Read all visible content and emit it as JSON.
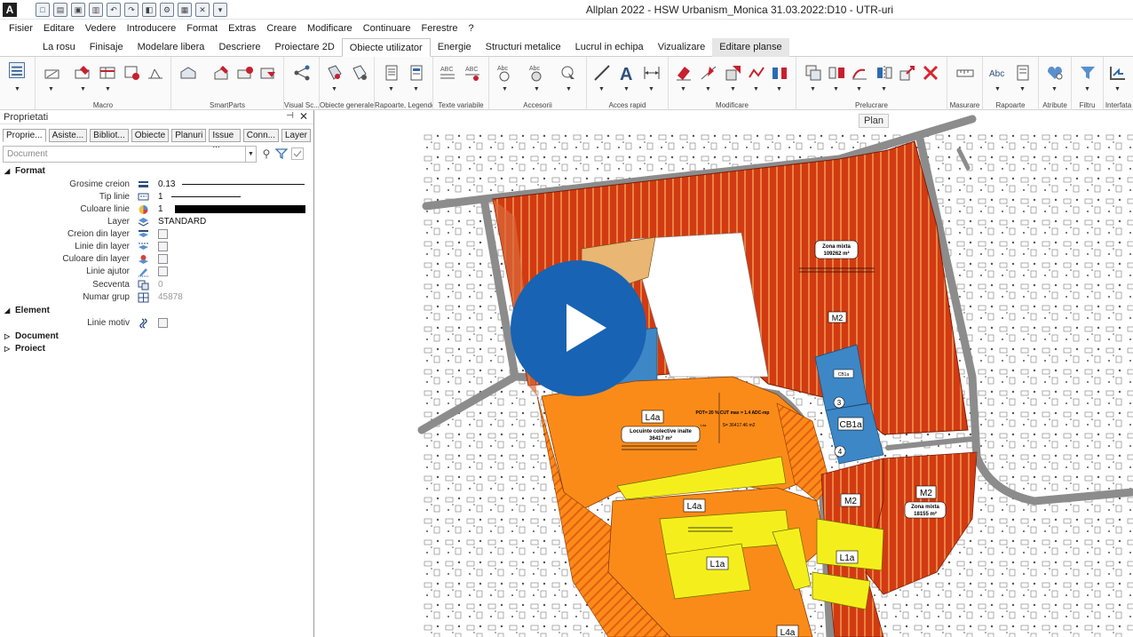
{
  "window": {
    "app_logo": "A",
    "title": "Allplan 2022 - HSW Urbanism_Monica 31.03.2022:D10 - UTR-uri"
  },
  "menu": [
    "Fisier",
    "Editare",
    "Vedere",
    "Introducere",
    "Format",
    "Extras",
    "Creare",
    "Modificare",
    "Continuare",
    "Ferestre",
    "?"
  ],
  "ribbon_tabs": [
    {
      "label": "La rosu"
    },
    {
      "label": "Finisaje"
    },
    {
      "label": "Modelare libera"
    },
    {
      "label": "Descriere"
    },
    {
      "label": "Proiectare 2D"
    },
    {
      "label": "Obiecte utilizator",
      "active": true
    },
    {
      "label": "Energie"
    },
    {
      "label": "Structuri metalice"
    },
    {
      "label": "Lucrul in echipa"
    },
    {
      "label": "Vizualizare"
    },
    {
      "label": "Editare planse",
      "special": true
    }
  ],
  "ribbon_groups": [
    "Macro",
    "SmartParts",
    "Visual Sc...",
    "Obiecte generale",
    "Rapoarte, Legende",
    "Texte variabile",
    "Accesorii",
    "Acces rapid",
    "Modificare",
    "Prelucrare",
    "Masurare",
    "Rapoarte",
    "Atribute",
    "Filtru",
    "Interfata"
  ],
  "ribbon_text": {
    "abc1": "ABC",
    "abc2": "ABC",
    "abc3": "Abc",
    "abc4": "Abc",
    "letter_a": "A"
  },
  "panel": {
    "title": "Proprietati",
    "pin": "⊣",
    "close": "✕",
    "tabs": [
      "Proprie...",
      "Asiste...",
      "Bibliot...",
      "Obiecte",
      "Planuri",
      "Issue ...",
      "Conn...",
      "Layer"
    ],
    "search_placeholder": "Document",
    "sections": {
      "format": "Format",
      "element": "Element",
      "document": "Document",
      "project": "Proiect"
    },
    "format_rows": {
      "pen": {
        "label": "Grosime creion",
        "value": "0.13"
      },
      "linetype": {
        "label": "Tip linie",
        "value": "1"
      },
      "linecolor": {
        "label": "Culoare linie",
        "value": "1"
      },
      "layer": {
        "label": "Layer",
        "value": "STANDARD"
      },
      "pen_from_layer": {
        "label": "Creion din layer"
      },
      "line_from_layer": {
        "label": "Linie din layer"
      },
      "color_from_layer": {
        "label": "Culoare din layer"
      },
      "helper_line": {
        "label": "Linie ajutor"
      },
      "sequence": {
        "label": "Secventa",
        "value": "0"
      },
      "group_number": {
        "label": "Numar grup",
        "value": "45878"
      }
    },
    "element_rows": {
      "pattern_line": {
        "label": "Linie motiv"
      }
    }
  },
  "canvas": {
    "view_tag": "Plan",
    "labels": {
      "zona_mixta_top": "Zona mixta",
      "zona_mixta_top_area": "109262 m²",
      "m2_top": "M2",
      "cb1a_top": "CB1a",
      "circle3": "3",
      "cb1a": "CB1a",
      "circle4": "4",
      "l4a_main": "L4a",
      "pot_text": "POT= 20 %  CUT max = 1.4 ADC-mp",
      "l4a_small": "L4a",
      "s_text": "S= 36417.46 m2",
      "locuinte": "Locuinte colective inalte",
      "locuinte_area": "36417 m²",
      "m2_mid": "M2",
      "m2_right": "M2",
      "zona_mixta_right": "Zona mixta",
      "zona_mixta_right_area": "18155 m²",
      "l4a_mid": "L4a",
      "l1a_left": "L1a",
      "l1a_right": "L1a",
      "l4a_bottom": "L4a"
    },
    "colors": {
      "mixed_zone": "#d23a12",
      "mixed_hatch": "#f5c26a",
      "residential_orange": "#fb8b18",
      "residential_yellow": "#f4ef1c",
      "blue_zone": "#3d87c6",
      "tan_zone": "#e9b673",
      "road": "#8c8c8c",
      "play_button": "#1863b3"
    }
  }
}
